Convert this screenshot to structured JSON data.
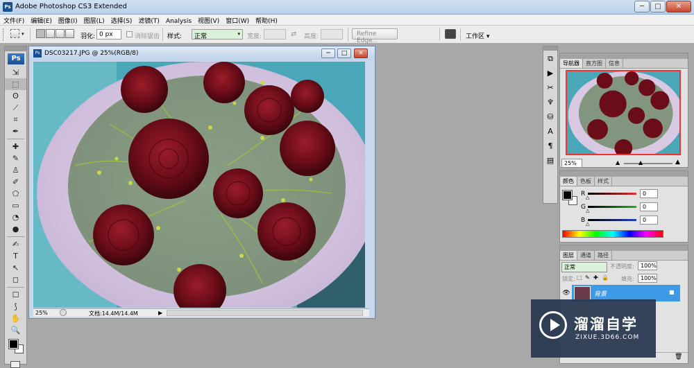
{
  "titlebar": {
    "app_title": "Adobe Photoshop CS3 Extended",
    "app_badge": "Ps",
    "minimize": "─",
    "maximize": "□",
    "close": "✕"
  },
  "menubar": {
    "items": [
      "文件(F)",
      "编辑(E)",
      "图像(I)",
      "图层(L)",
      "选择(S)",
      "滤镜(T)",
      "Analysis",
      "视图(V)",
      "窗口(W)",
      "帮助(H)"
    ]
  },
  "options": {
    "feather_label": "羽化:",
    "feather_value": "0 px",
    "antialias_label": "消除锯齿",
    "style_label": "样式:",
    "style_value": "正常",
    "width_label": "宽度:",
    "height_label": "高度:",
    "refine_edge": "Refine Edge...",
    "workspace": "工作区 ▾"
  },
  "tools": {
    "logo": "Ps",
    "items": [
      "⇲",
      "⬚",
      "ʘ",
      "⟋",
      "⌗",
      "✒",
      "✚",
      "✎",
      "♙",
      "✐",
      "⬠",
      "▭",
      "◔",
      "●",
      "✍",
      "T",
      "↖",
      "◻",
      "☐",
      "⟆",
      "✋",
      "🔍"
    ]
  },
  "document": {
    "title": "DSC03217.JPG @ 25%(RGB/8)",
    "zoom": "25%",
    "doc_info": "文档:14.4M/14.4M",
    "icon": "Ps"
  },
  "navigator": {
    "tabs": [
      "导航器",
      "直方图",
      "信息"
    ],
    "zoom": "25%"
  },
  "color": {
    "tabs": [
      "颜色",
      "色板",
      "样式"
    ],
    "channels": [
      {
        "label": "R",
        "value": "0",
        "color": "#e03030"
      },
      {
        "label": "G",
        "value": "0",
        "color": "#28b028"
      },
      {
        "label": "B",
        "value": "0",
        "color": "#2040c0"
      }
    ]
  },
  "layers": {
    "tabs": [
      "图层",
      "通道",
      "路径"
    ],
    "blend_mode": "正常",
    "opacity_label": "不透明度:",
    "opacity_value": "100%",
    "lock_label": "锁定:",
    "fill_label": "填充:",
    "fill_value": "100%",
    "layer_name": "背景"
  },
  "watermark": {
    "brand": "溜溜自学",
    "url": "ZIXUE.3D66.COM"
  },
  "colors": {
    "accent": "#3c9ae6",
    "watermark_bg": "#25344e"
  }
}
